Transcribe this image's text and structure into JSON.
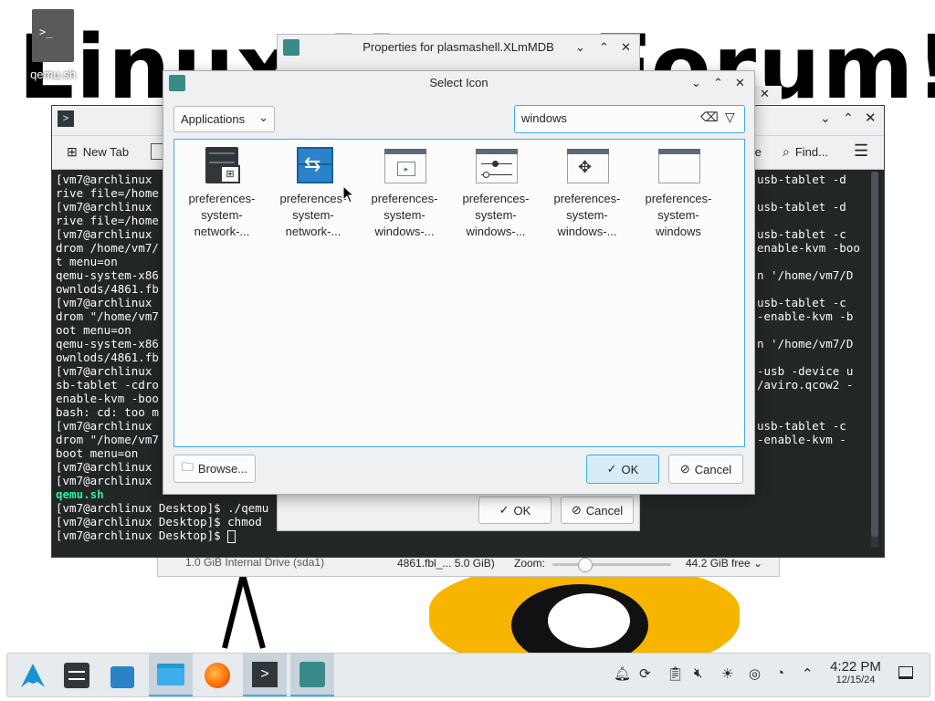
{
  "desktop": {
    "wallpaper_text": "Linux User Forum!",
    "file_icon_label": "qemu.sh"
  },
  "terminal": {
    "new_tab_label": "New Tab",
    "find_label": "Find...",
    "left_lines": [
      "[vm7@archlinux",
      "rive file=/home",
      "[vm7@archlinux",
      "rive file=/home",
      "[vm7@archlinux",
      "drom /home/vm7/",
      "t menu=on",
      "qemu-system-x86",
      "ownlods/4861.fb",
      "[vm7@archlinux",
      "drom \"/home/vm7",
      "oot menu=on",
      "qemu-system-x86",
      "ownlods/4861.fb",
      "[vm7@archlinux",
      "sb-tablet -cdro",
      "enable-kvm -boo",
      "bash: cd: too m",
      "[vm7@archlinux",
      "drom \"/home/vm7",
      "boot menu=on",
      "[vm7@archlinux",
      "[vm7@archlinux"
    ],
    "green_line": "qemu.sh",
    "bottom_lines": [
      "[vm7@archlinux Desktop]$ ./qemu",
      "[vm7@archlinux Desktop]$ chmod",
      "[vm7@archlinux Desktop]$ "
    ],
    "right_lines": [
      {
        "row": 0,
        "text": "usb-tablet -d"
      },
      {
        "row": 2,
        "text": "usb-tablet -d"
      },
      {
        "row": 4,
        "text": "usb-tablet -c"
      },
      {
        "row": 5,
        "text": "enable-kvm -boo"
      },
      {
        "row": 7,
        "text": "n '/home/vm7/D"
      },
      {
        "row": 9,
        "text": "usb-tablet -c"
      },
      {
        "row": 10,
        "text": "-enable-kvm -b"
      },
      {
        "row": 12,
        "text": "n '/home/vm7/D"
      },
      {
        "row": 14,
        "text": "-usb -device u"
      },
      {
        "row": 15,
        "text": "/aviro.qcow2 -"
      },
      {
        "row": 18,
        "text": "usb-tablet -c"
      },
      {
        "row": 19,
        "text": "-enable-kvm -"
      }
    ],
    "right_col_label": "te"
  },
  "properties_window": {
    "title": "Properties for plasmashell.XLmMDB",
    "ok_label": "OK",
    "cancel_label": "Cancel"
  },
  "dolphin_strip": {
    "drive_label": "1.0 GiB Internal Drive (sda1)",
    "file_info": "4861.fbl_... 5.0 GiB)",
    "zoom_label": "Zoom:",
    "free_label": "44.2 GiB free"
  },
  "dialog": {
    "title": "Select Icon",
    "category": "Applications",
    "search_value": "windows",
    "icons": [
      {
        "line1": "preferences-",
        "line2": "system-",
        "line3": "network-..."
      },
      {
        "line1": "preferences-",
        "line2": "system-",
        "line3": "network-..."
      },
      {
        "line1": "preferences-",
        "line2": "system-",
        "line3": "windows-..."
      },
      {
        "line1": "preferences-",
        "line2": "system-",
        "line3": "windows-..."
      },
      {
        "line1": "preferences-",
        "line2": "system-",
        "line3": "windows-..."
      },
      {
        "line1": "preferences-",
        "line2": "system-",
        "line3": "windows"
      }
    ],
    "browse_label": "Browse...",
    "ok_label": "OK",
    "cancel_label": "Cancel"
  },
  "taskbar": {
    "time": "4:22 PM",
    "date": "12/15/24"
  },
  "colors": {
    "accent": "#3daee9",
    "terminal_bg": "#232627",
    "window_bg": "#eff0f1"
  }
}
